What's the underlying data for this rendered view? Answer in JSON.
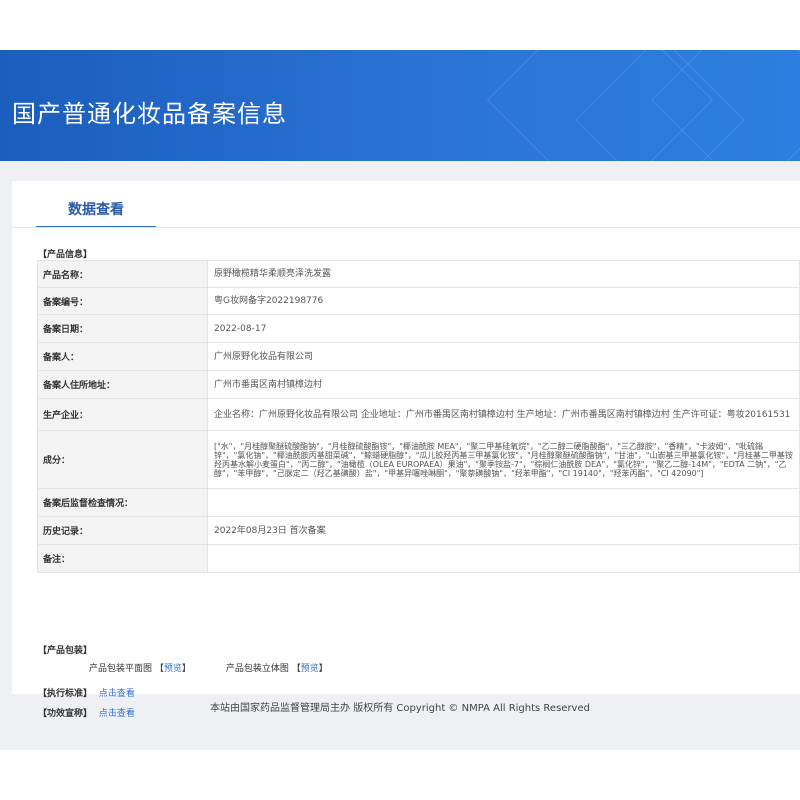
{
  "header": {
    "title": "国产普通化妆品备案信息"
  },
  "tab": {
    "label": "数据查看"
  },
  "product_info": {
    "section_label": "【产品信息】",
    "rows": [
      {
        "label": "产品名称：",
        "value": "原野橄榄精华柔顺亮泽洗发露"
      },
      {
        "label": "备案编号：",
        "value": "粤G妆网备字2022198776"
      },
      {
        "label": "备案日期：",
        "value": "2022-08-17"
      },
      {
        "label": "备案人：",
        "value": "广州原野化妆品有限公司"
      },
      {
        "label": "备案人住所地址：",
        "value": "广州市番禺区南村镇樟边村"
      },
      {
        "label": "生产企业：",
        "value": "企业名称：广州原野化妆品有限公司 企业地址：广州市番禺区南村镇樟边村 生产地址：广州市番禺区南村镇樟边村 生产许可证：粤妆20161531"
      },
      {
        "label": "成分：",
        "value": "[\"水\"，\"月桂醇聚醚硫酸酯钠\"，\"月桂醇硫酸酯铵\"，\"椰油酰胺 MEA\"，\"聚二甲基硅氧烷\"，\"乙二醇二硬脂酸酯\"，\"三乙醇胺\"，\"香精\"，\"卡波姆\"，\"吡硫鎓锌\"，\"氯化钠\"，\"椰油酰胺丙基甜菜碱\"，\"鲸蜡硬脂醇\"，\"瓜儿胶羟丙基三甲基氯化铵\"，\"月桂醇聚醚硫酸酯钠\"，\"甘油\"，\"山嵛基三甲基氯化铵\"，\"月桂基二甲基铵羟丙基水解小麦蛋白\"，\"丙二醇\"，\"油橄榄（OLEA EUROPAEA）果油\"，\"聚季铵盐-7\"，\"棕榈仁油酰胺 DEA\"，\"氯化锌\"，\"聚乙二醇-14M\"，\"EDTA 二钠\"，\"乙醇\"，\"苯甲醇\"，\"己脒定二（羟乙基磺酸）盐\"，\"甲基异噻唑啉酮\"，\"聚萘磺酸钠\"，\"羟苯甲酯\"，\"CI 19140\"，\"羟苯丙酯\"，\"CI 42090\"]"
      },
      {
        "label": "备案后监督检查情况：",
        "value": ""
      },
      {
        "label": "历史记录：",
        "value": "2022年08月23日 首次备案"
      },
      {
        "label": "备注：",
        "value": ""
      }
    ]
  },
  "packaging": {
    "section_label": "【产品包装】",
    "flat_label": "产品包装平面图",
    "solid_label": "产品包装立体图",
    "preview_link": "预览",
    "bracket_open": "【",
    "bracket_close": "】"
  },
  "standard": {
    "label": "【执行标准】",
    "link": "点击查看"
  },
  "efficacy": {
    "label": "【功效宣称】",
    "link": "点击查看"
  },
  "footer": {
    "text": "本站由国家药品监督管理局主办 版权所有 Copyright © NMPA All Rights Reserved"
  },
  "colors": {
    "banner": "#2b74d6",
    "accent": "#2f6fd0",
    "label_bg": "#f3f3f3",
    "page_bg": "#eef0f3"
  }
}
